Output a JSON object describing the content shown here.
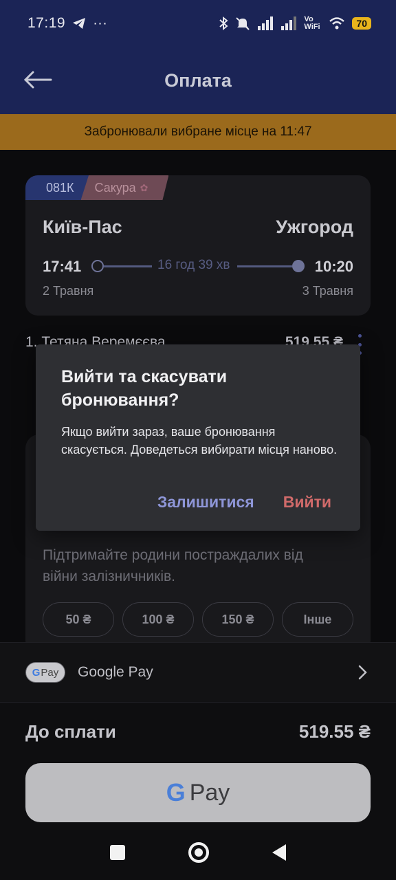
{
  "status_bar": {
    "time": "17:19",
    "telegram_icon": "telegram-icon",
    "more": "···",
    "icons": [
      "bluetooth-icon",
      "mute-icon",
      "signal-icon",
      "signal-icon",
      "vowifi-icon",
      "wifi-icon"
    ],
    "vowifi": "Vo WiFi",
    "battery": "70"
  },
  "header": {
    "title": "Оплата",
    "back_icon": "arrow-left-icon"
  },
  "reservation_notice": "Забронювали вибране місце на 11:47",
  "trip": {
    "train_number": "081К",
    "train_brand": "Сакура",
    "from": "Київ-Пас",
    "to": "Ужгород",
    "departure_time": "17:41",
    "arrival_time": "10:20",
    "duration": "16 год 39 хв",
    "departure_date": "2 Травня",
    "arrival_date": "3 Травня"
  },
  "passenger": {
    "name": "1. Тетяна Веремєєва",
    "price": "519.55 ₴"
  },
  "donation": {
    "text": "Підтримайте родини постраждалих від війни залізничників.",
    "amounts": [
      "50 ₴",
      "100 ₴",
      "150 ₴",
      "Інше"
    ]
  },
  "payment": {
    "method_chip": "Pay",
    "method_label": "Google Pay",
    "total_label": "До сплати",
    "total_value": "519.55 ₴",
    "button_label": "Pay"
  },
  "dialog": {
    "title": "Вийти та скасувати бронювання?",
    "message": "Якщо вийти зараз, ваше бронювання скасується. Доведеться вибирати місця наново.",
    "stay_label": "Залишитися",
    "exit_label": "Вийти"
  },
  "colors": {
    "header": "#1b2456",
    "notice": "#9b6a1c",
    "dialog": "#2e2f33",
    "stay_action": "#8e96d8",
    "exit_action": "#d06a6a"
  }
}
